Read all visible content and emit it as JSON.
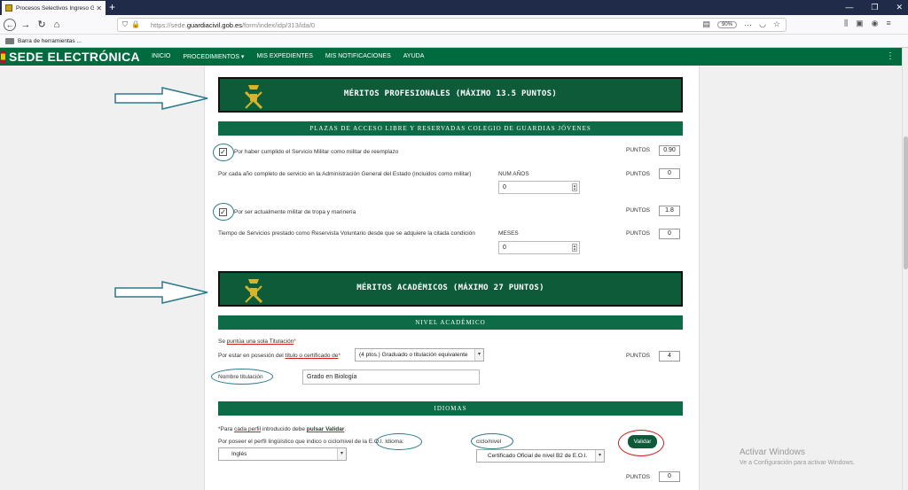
{
  "browser": {
    "tab_title": "Procesos Selectivos Ingreso GC",
    "url_prefix": "https://sede.",
    "url_host": "guardiacivil.gob.es",
    "url_path": "/form/index/idp/313/ida/0",
    "zoom": "90%",
    "bookmarks_label": "Barra de herramientas ..."
  },
  "site": {
    "brand": "SEDE ELECTRÓNICA",
    "menu": [
      "INICIO",
      "PROCEDIMIENTOS ▾",
      "MIS EXPEDIENTES",
      "MIS NOTIFICACIONES",
      "AYUDA"
    ]
  },
  "profesionales": {
    "title": "MÉRITOS PROFESIONALES (MÁXIMO 13.5 PUNTOS)",
    "subtitle": "PLAZAS DE ACCESO LIBRE Y RESERVADAS COLEGIO DE GUARDIAS JÓVENES",
    "servicio_militar": {
      "label": "Por haber cumplido el Servicio Militar como militar de reemplazo",
      "checked": "✓",
      "puntos_label": "PUNTOS",
      "puntos": "0.90"
    },
    "anios_servicio": {
      "label": "Por cada año completo de servicio en la Administración General del Estado (incluidos como militar)",
      "unit_label": "NUM AÑOS",
      "value": "0",
      "puntos_label": "PUNTOS",
      "puntos": "0"
    },
    "militar_tropa": {
      "label": "Por ser actualmente militar de tropa y marinería",
      "checked": "✓",
      "puntos_label": "PUNTOS",
      "puntos": "1.8"
    },
    "reservista": {
      "label": "Tiempo de Servicios prestado como Reservista Voluntario desde que se adquiere la citada condición",
      "unit_label": "MESES",
      "value": "0",
      "puntos_label": "PUNTOS",
      "puntos": "0"
    }
  },
  "academicos": {
    "title": "MÉRITOS ACADÉMICOS (MÁXIMO 27 PUNTOS)",
    "nivel_title": "NIVEL ACADÉMICO",
    "note_pre": "Se ",
    "note_u": "puntúa una sola Titulación",
    "note_post": "*",
    "posesion_pre": "Por estar en posesión del ",
    "posesion_u": "título o certificado de",
    "posesion_post": "*",
    "titulacion_select": "(4 ptos.) Graduado o titulación equivalente",
    "puntos_label": "PUNTOS",
    "puntos": "4",
    "nombre_label": "Nombre titulación",
    "nombre_value": "Grado en Biología"
  },
  "idiomas": {
    "title": "IDIOMAS",
    "note_a": "*Para ",
    "note_b": "cada perfil",
    "note_c": " introducido debe ",
    "note_d": "pulsar Validar",
    "note_e": ".",
    "perfil_label": "Por poseer el perfil lingüístico que indico o ciclo/nivel de la E.O.I. Idioma:",
    "idioma_select": "Inglés",
    "ciclo_label": "ciclo/nivel",
    "ciclo_select": "Certificado Oficial de nivel B2 de E.O.I.",
    "validar": "Validar",
    "puntos_label": "PUNTOS",
    "puntos": "0"
  },
  "watermark": {
    "title": "Activar Windows",
    "subtitle": "Ve a Configuración para activar Windows."
  }
}
